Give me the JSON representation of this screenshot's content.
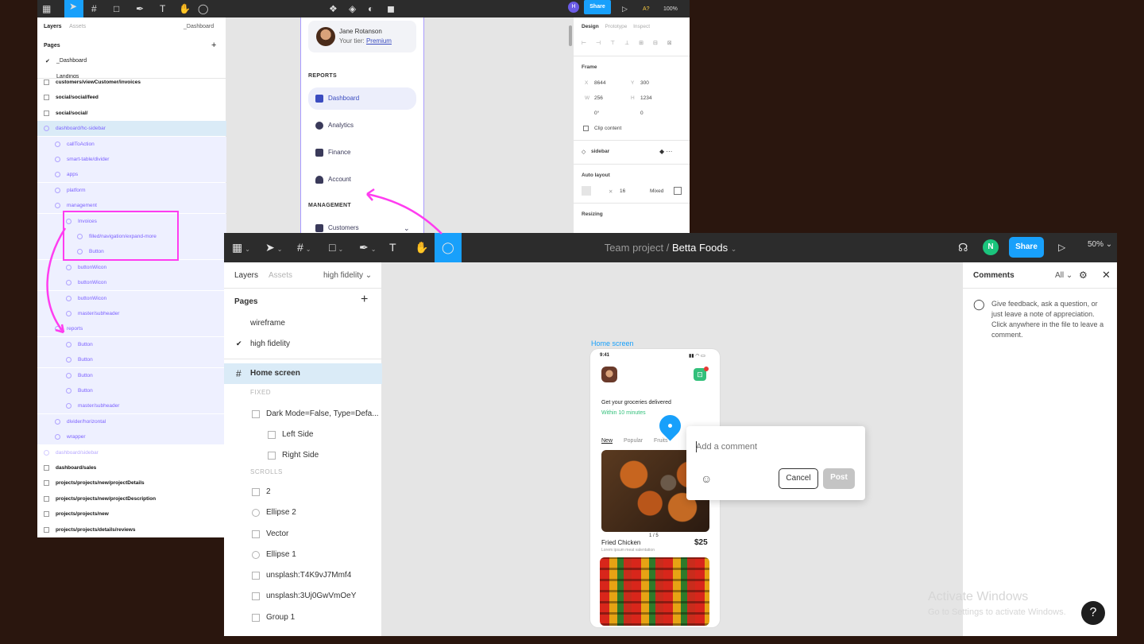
{
  "back_window": {
    "toolbar": {
      "avatar_letter": "H",
      "share_label": "Share",
      "extra_label": "A?",
      "zoom": "100%"
    },
    "left_panel": {
      "tab_layers": "Layers",
      "tab_assets": "Assets",
      "page_dropdown": "_Dashboard",
      "pages_title": "Pages",
      "pages": [
        "_Dashboard",
        "Landings"
      ],
      "layers": [
        {
          "text": "customers/viewCustomer/invoices",
          "style": "bold"
        },
        {
          "text": "social/social/feed",
          "style": "bold"
        },
        {
          "text": "social/social/",
          "style": "bold"
        },
        {
          "text": "dashboard/hc-sidebar",
          "style": "purple-sel"
        },
        {
          "text": "callToAction",
          "style": "purple"
        },
        {
          "text": "smart-table/divider",
          "style": "purple"
        },
        {
          "text": "apps",
          "style": "purple"
        },
        {
          "text": "platform",
          "style": "purple"
        },
        {
          "text": "management",
          "style": "purple"
        },
        {
          "text": "Invoices",
          "style": "purple"
        },
        {
          "text": "filled/navigation/expand-more",
          "style": "purple"
        },
        {
          "text": "Button",
          "style": "purple"
        },
        {
          "text": "buttonWicon",
          "style": "purple"
        },
        {
          "text": "buttonWicon",
          "style": "purple"
        },
        {
          "text": "buttonWicon",
          "style": "purple"
        },
        {
          "text": "master/subheader",
          "style": "purple"
        },
        {
          "text": "reports",
          "style": "purple"
        },
        {
          "text": "Button",
          "style": "purple"
        },
        {
          "text": "Button",
          "style": "purple"
        },
        {
          "text": "Button",
          "style": "purple"
        },
        {
          "text": "Button",
          "style": "purple"
        },
        {
          "text": "master/subheader",
          "style": "purple"
        },
        {
          "text": "divider/horizontal",
          "style": "purple"
        },
        {
          "text": "wrapper",
          "style": "purple"
        },
        {
          "text": "dashboard/sidebar",
          "style": "faded"
        },
        {
          "text": "dashboard/sales",
          "style": "bold"
        },
        {
          "text": "projects/projects/new/projectDetails",
          "style": "bold"
        },
        {
          "text": "projects/projects/new/projectDescription",
          "style": "bold"
        },
        {
          "text": "projects/projects/new",
          "style": "bold"
        },
        {
          "text": "projects/projects/details/reviews",
          "style": "bold"
        }
      ]
    },
    "sidebar": {
      "user_name": "Jane Rotanson",
      "tier_label": "Your tier:",
      "tier_value": "Premium",
      "reports_title": "REPORTS",
      "items": [
        "Dashboard",
        "Analytics",
        "Finance",
        "Account"
      ],
      "management_title": "MANAGEMENT",
      "management_item": "Customers"
    },
    "right_panel": {
      "tab_design": "Design",
      "tab_prototype": "Prototype",
      "tab_inspect": "Inspect",
      "frame_label": "Frame",
      "x_label": "X",
      "x_value": "8644",
      "y_label": "Y",
      "y_value": "300",
      "w_label": "W",
      "w_value": "256",
      "h_label": "H",
      "h_value": "1234",
      "rotation": "0°",
      "radius": "0",
      "clip_content": "Clip content",
      "component": "sidebar",
      "auto_layout": "Auto layout",
      "spacing": "16",
      "mixed": "Mixed",
      "resizing": "Resizing"
    }
  },
  "front_window": {
    "toolbar": {
      "project": "Team project",
      "separator": "/",
      "file": "Betta Foods",
      "avatar_letter": "N",
      "share_label": "Share",
      "zoom": "50%"
    },
    "left_panel": {
      "tab_layers": "Layers",
      "tab_assets": "Assets",
      "page_dropdown": "high fidelity",
      "pages_title": "Pages",
      "pages": [
        "wireframe",
        "high fidelity"
      ],
      "layers": [
        {
          "text": "Home screen",
          "kind": "frame"
        },
        {
          "text": "FIXED",
          "kind": "section"
        },
        {
          "text": "Dark Mode=False, Type=Defa...",
          "kind": "component"
        },
        {
          "text": "Left Side",
          "kind": "frame-child"
        },
        {
          "text": "Right Side",
          "kind": "frame-child"
        },
        {
          "text": "SCROLLS",
          "kind": "section"
        },
        {
          "text": "2",
          "kind": "text"
        },
        {
          "text": "Ellipse 2",
          "kind": "ellipse"
        },
        {
          "text": "Vector",
          "kind": "vector"
        },
        {
          "text": "Ellipse 1",
          "kind": "ellipse"
        },
        {
          "text": "unsplash:T4K9vJ7Mmf4",
          "kind": "image"
        },
        {
          "text": "unsplash:3Uj0GwVmOeY",
          "kind": "image"
        },
        {
          "text": "Group 1",
          "kind": "group"
        }
      ]
    },
    "canvas": {
      "frame_label": "Home screen",
      "phone": {
        "time": "9:41",
        "headline": "Get your groceries delivered",
        "subline": "Within 10 minutes",
        "tabs": [
          "New",
          "Popular",
          "Fruits"
        ],
        "counter": "1 / 5",
        "item_name": "Fried Chicken",
        "item_sub": "Lorem ipsum meat valentation",
        "item_price": "$25"
      },
      "comment": {
        "placeholder": "Add a comment",
        "cancel": "Cancel",
        "post": "Post"
      }
    },
    "right_panel": {
      "title": "Comments",
      "filter": "All",
      "hint": "Give feedback, ask a question, or just leave a note of appreciation. Click anywhere in the file to leave a comment."
    }
  },
  "overlay": {
    "activate_title": "Activate Windows",
    "activate_sub": "Go to Settings to activate Windows.",
    "help": "?"
  },
  "colors": {
    "accent": "#18a0fb",
    "annotation": "#ff3df0",
    "layer_purple": "#7b61ff",
    "success": "#1bc47d"
  }
}
